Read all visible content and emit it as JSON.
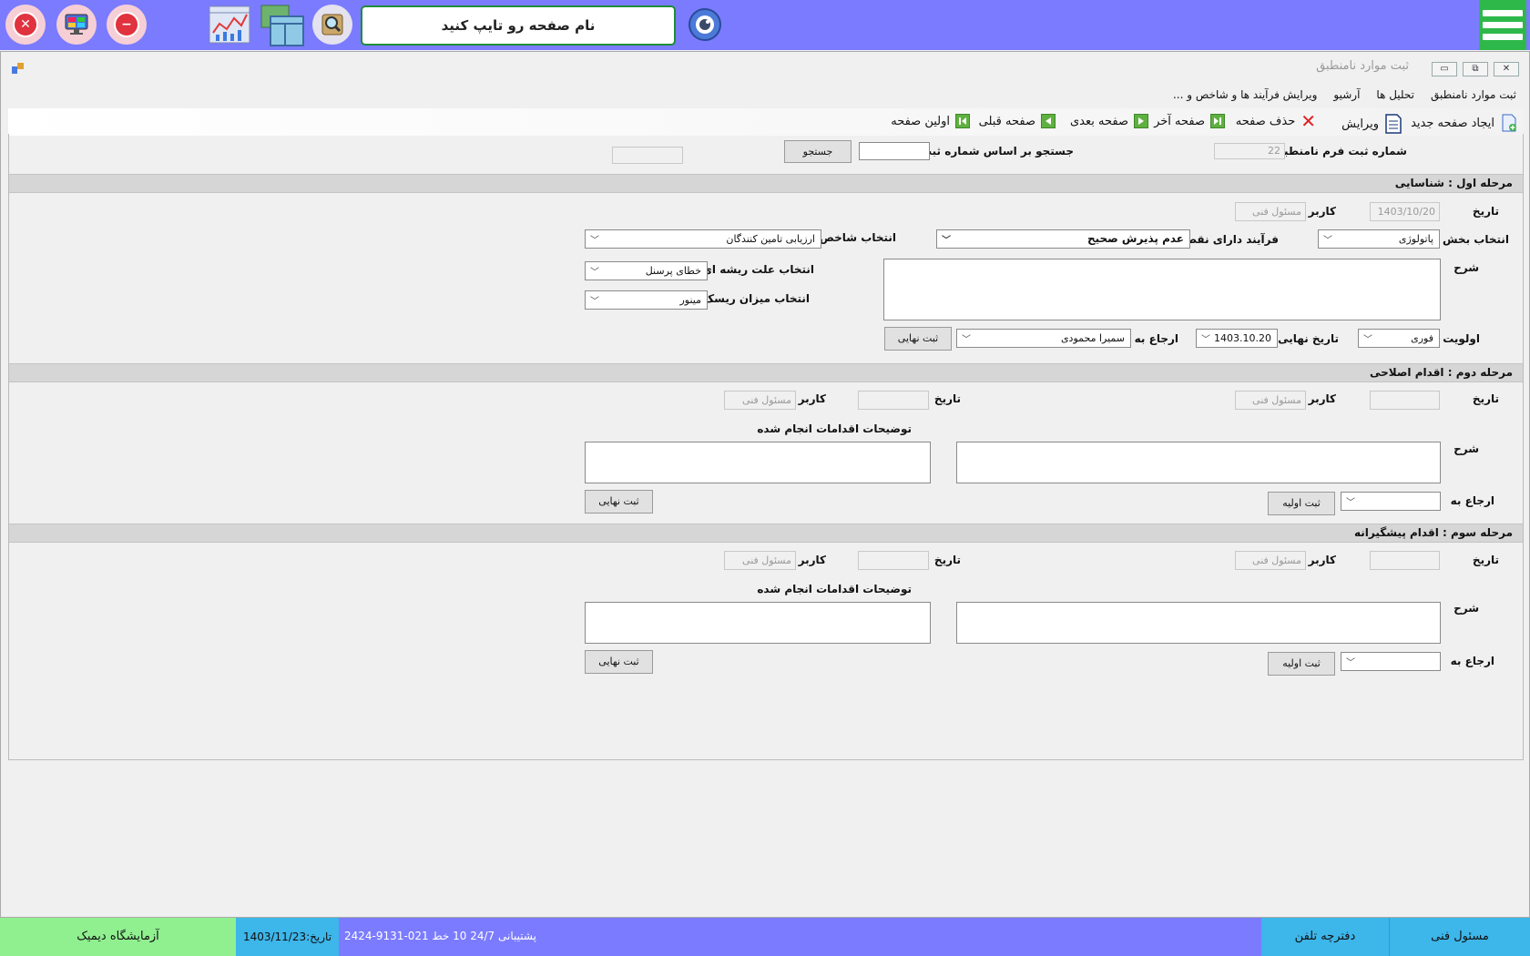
{
  "topbar": {
    "search_placeholder": "نام صفحه رو تایپ کنید",
    "colors": {
      "bar": "#7b7bff",
      "menu": "#2fb84a",
      "search_border": "#1e8c3a"
    }
  },
  "window": {
    "title": "ثبت موارد نامنطبق"
  },
  "tabs": [
    "ثبت موارد نامنطبق",
    "تحلیل ها",
    "آرشیو",
    "... ویرایش فرآیند ها و شاخص و"
  ],
  "toolbar": {
    "new_page": "ایجاد صفحه جدید",
    "edit": "ویرایش",
    "delete_page": "حذف صفحه",
    "last_page": "صفحه آخر",
    "next_page": "صفحه بعدی",
    "prev_page": "صفحه قبلی",
    "first_page": "اولین صفحه"
  },
  "search_row": {
    "form_number_label": "شماره ثبت فرم نامنطبق",
    "form_number_value": "22",
    "search_label": "جستجو بر اساس شماره ثبت",
    "search_value": "",
    "search_button": "جستجو"
  },
  "stage1": {
    "title": "مرحله اول : شناسایی",
    "date_label": "تاریخ",
    "date_value": "1403/10/20",
    "user_label": "کاربر",
    "user_value": "مسئول فنی",
    "department_label": "انتخاب بخش",
    "department_value": "پاتولوژی",
    "process_label": "فرآیند دارای نقص",
    "process_value": "عدم پذیرش صحیح",
    "indicator_label": "انتخاب شاخص",
    "indicator_value": "ارزیابی تامین کنندگان",
    "description_label": "شرح",
    "root_cause_label": "انتخاب علت ریشه ای",
    "root_cause_value": "خطای پرسنل",
    "risk_label": "انتخاب میزان ریسک",
    "risk_value": "مینور",
    "priority_label": "اولویت",
    "priority_value": "فوری",
    "deadline_label": "تاریخ نهایی",
    "deadline_value": "1403.10.20",
    "refer_label": "ارجاع به",
    "refer_value": "سمیرا محمودی",
    "final_button": "ثبت نهایی"
  },
  "stage2": {
    "title": "مرحله دوم : اقدام اصلاحی",
    "date_label": "تاریخ",
    "user_label": "کاربر",
    "user_value": "مسئول فنی",
    "date2_label": "تاریخ",
    "user2_label": "کاربر",
    "user2_value": "مسئول فنی",
    "actions_label": "توضیحات اقدامات انجام شده",
    "description_label": "شرح",
    "refer_label": "ارجاع به",
    "initial_button": "ثبت اولیه",
    "final_button": "ثبت نهایی"
  },
  "stage3": {
    "title": "مرحله سوم : اقدام پیشگیرانه",
    "date_label": "تاریخ",
    "user_label": "کاربر",
    "user_value": "مسئول فنی",
    "date2_label": "تاریخ",
    "user2_label": "کاربر",
    "user2_value": "مسئول فنی",
    "actions_label": "توضیحات اقدامات انجام شده",
    "description_label": "شرح",
    "refer_label": "ارجاع به",
    "initial_button": "ثبت اولیه",
    "final_button": "ثبت نهایی"
  },
  "statusbar": {
    "lab_name": "آزمایشگاه دیمیک",
    "date": "تاریخ:1403/11/23",
    "support": "پشتیبانی 24/7    10 خط  021-9131-2424",
    "phone_book": "دفترچه تلفن",
    "role": "مسئول فنی",
    "colors": {
      "green": "#90f090",
      "blue": "#3db6ea"
    }
  },
  "icons": [
    "close-icon",
    "monitor-icon",
    "minus-icon",
    "chart-icon",
    "windows-icon",
    "search-icon",
    "eye-icon",
    "hamburger-menu-icon"
  ]
}
